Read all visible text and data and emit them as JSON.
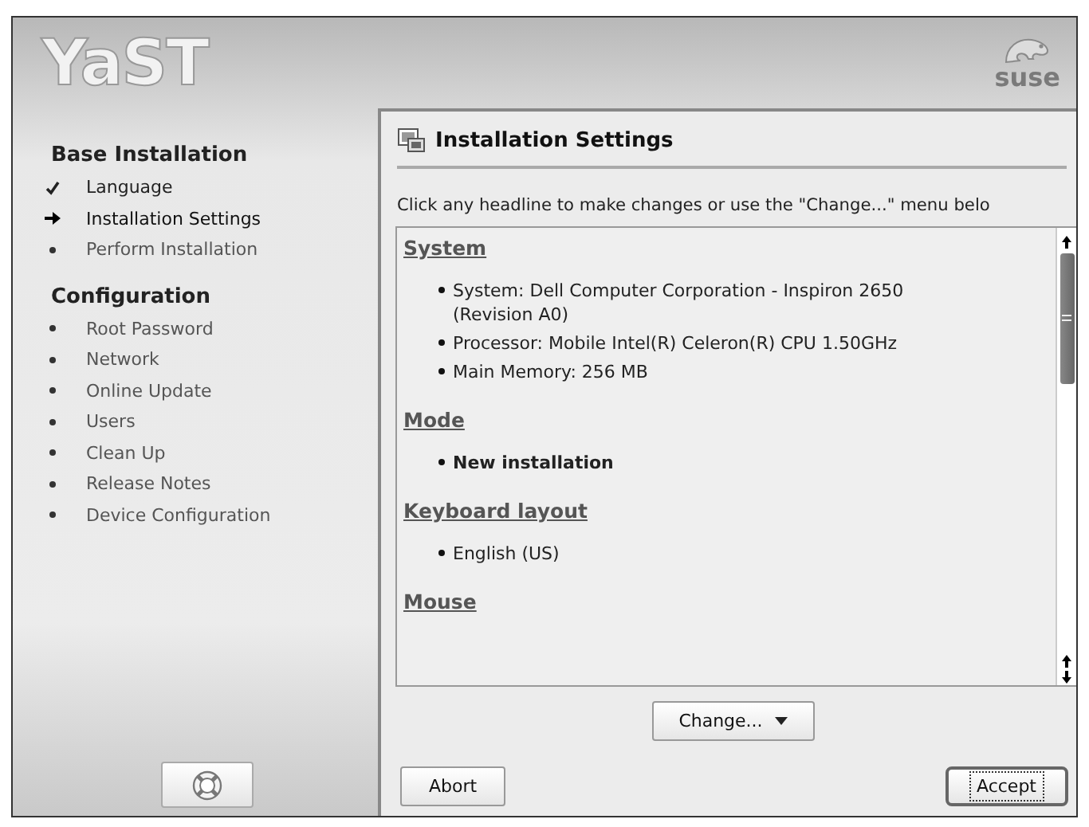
{
  "header": {
    "logo": "YaST",
    "brand": "suse"
  },
  "sidebar": {
    "groups": [
      {
        "title": "Base Installation",
        "items": [
          {
            "label": "Language",
            "kind": "done"
          },
          {
            "label": "Installation Settings",
            "kind": "current"
          },
          {
            "label": "Perform Installation",
            "kind": "pending"
          }
        ]
      },
      {
        "title": "Configuration",
        "items": [
          {
            "label": "Root Password",
            "kind": "pending"
          },
          {
            "label": "Network",
            "kind": "pending"
          },
          {
            "label": "Online Update",
            "kind": "pending"
          },
          {
            "label": "Users",
            "kind": "pending"
          },
          {
            "label": "Clean Up",
            "kind": "pending"
          },
          {
            "label": "Release Notes",
            "kind": "pending"
          },
          {
            "label": "Device Configuration",
            "kind": "pending"
          }
        ]
      }
    ]
  },
  "panel": {
    "title": "Installation Settings",
    "instruction": "Click any headline to make changes or use the \"Change...\" menu belo",
    "sections": [
      {
        "heading": "System",
        "items": [
          {
            "text": "System: Dell Computer Corporation - Inspiron 2650 (Revision A0)",
            "bold": false
          },
          {
            "text": "Processor: Mobile Intel(R) Celeron(R) CPU 1.50GHz",
            "bold": false
          },
          {
            "text": "Main Memory: 256 MB",
            "bold": false
          }
        ]
      },
      {
        "heading": "Mode",
        "items": [
          {
            "text": "New installation",
            "bold": true
          }
        ]
      },
      {
        "heading": "Keyboard layout",
        "items": [
          {
            "text": "English (US)",
            "bold": false
          }
        ]
      },
      {
        "heading": "Mouse"
      }
    ],
    "change_button": "Change...",
    "buttons": [
      {
        "label": "Abort",
        "default": false
      },
      {
        "label": "Accept",
        "default": true
      }
    ]
  }
}
